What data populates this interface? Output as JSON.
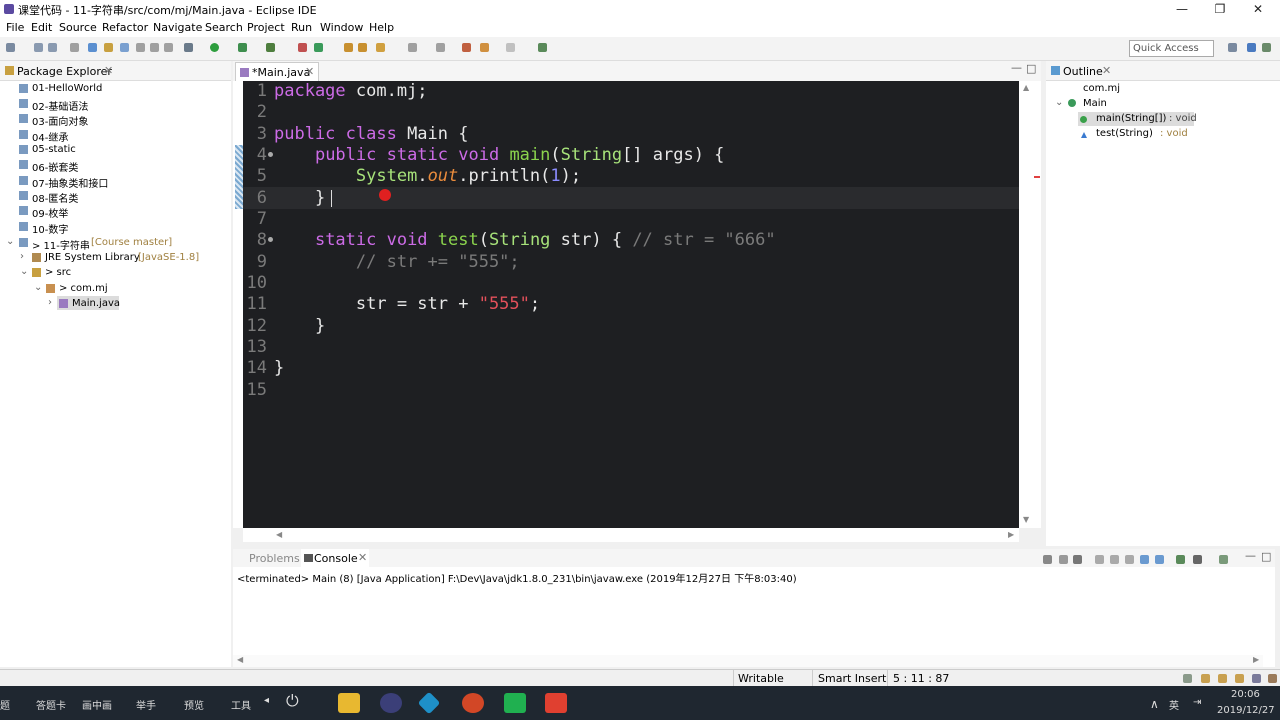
{
  "window": {
    "title": "课堂代码 - 11-字符串/src/com/mj/Main.java - Eclipse IDE"
  },
  "menu": [
    "File",
    "Edit",
    "Source",
    "Refactor",
    "Navigate",
    "Search",
    "Project",
    "Run",
    "Window",
    "Help"
  ],
  "quick_access": "Quick Access",
  "package_explorer": {
    "title": "Package Explorer",
    "items": [
      "01-HelloWorld",
      "02-基础语法",
      "03-面向对象",
      "04-继承",
      "05-static",
      "06-嵌套类",
      "07-抽象类和接口",
      "08-匿名类",
      "09-枚举",
      "10-数字"
    ],
    "project": "> 11-字符串",
    "project_branch": "[Course master]",
    "jre": "JRE System Library",
    "jre_version": "[JavaSE-1.8]",
    "src": "> src",
    "package": "> com.mj",
    "file": "Main.java"
  },
  "editor": {
    "tab": "*Main.java",
    "line_numbers": [
      "1",
      "2",
      "3",
      "4",
      "5",
      "6",
      "7",
      "8",
      "9",
      "10",
      "11",
      "12",
      "13",
      "14",
      "15"
    ]
  },
  "outline": {
    "title": "Outline",
    "package": "com.mj",
    "class": "Main",
    "method1": "main(String[])",
    "method1_type": ": void",
    "method2": "test(String)",
    "method2_type": ": void"
  },
  "console": {
    "tab_problems": "Problems",
    "tab_console": "Console",
    "output": "<terminated> Main (8) [Java Application] F:\\Dev\\Java\\jdk1.8.0_231\\bin\\javaw.exe (2019年12月27日 下午8:03:40)"
  },
  "status": {
    "writable": "Writable",
    "insert": "Smart Insert",
    "position": "5 : 11 : 87"
  },
  "taskbar": {
    "items": [
      "题",
      "答题卡",
      "画中画",
      "举手",
      "预览",
      "工具"
    ],
    "ime": "英",
    "time": "20:06",
    "date": "2019/12/27"
  }
}
